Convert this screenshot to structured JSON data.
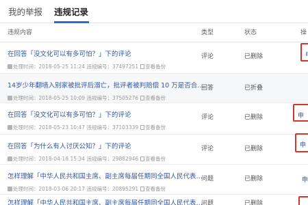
{
  "tabs": [
    "我的举报",
    "违规记录"
  ],
  "table": {
    "headers": [
      "违规内容",
      "类型",
      "状态",
      "操"
    ],
    "rows": [
      {
        "title": "在回答「没文化可以有多可怕？」下的评论",
        "meta": "处理时间：2018-05-25 11:24 违规编号：37497251",
        "view": "查看备份",
        "type": "评论",
        "status": "已删除",
        "action": "申"
      },
      {
        "title": "14岁少年翻墙入别家被批评后溺亡，批评者被判赔偿 10 万是否合…",
        "meta": "处理时间：2018-05-25 10:09 违规编号：37505276",
        "view": "查看备份",
        "type": "回答",
        "status": "已折叠",
        "action": ""
      },
      {
        "title": "在回答「没文化可以有多可怕？」下的评论",
        "meta": "处理时间：2018-05-23 10:47 违规编号：37103339",
        "view": "查看备份",
        "type": "评论",
        "status": "已删除",
        "action": "申"
      },
      {
        "title": "在回答「为什么有人讨厌公知？」下的评论",
        "meta": "处理时间：2018-04-18 15:34 违规编号：29882946",
        "view": "查看备份",
        "type": "评论",
        "status": "已删除",
        "action": "申"
      },
      {
        "title": "怎样理解「中华人民共和国主席、副主席每届任期同全国人民代表…",
        "meta": "处理时间：2018-03-06 20:17 违规编号：20895291",
        "view": "查看备份",
        "type": "问题",
        "status": "已删除",
        "action": "申"
      },
      {
        "title": "怎样理解「中华人民共和国主席、副主席每届任期同全国人民代表…",
        "meta": "",
        "view": "",
        "type": "问题",
        "status": "已删除",
        "action": ""
      }
    ]
  },
  "colors": {
    "link": "#34579e",
    "highlight_border": "#d3342c",
    "tab_accent": "#2a6bd6"
  }
}
